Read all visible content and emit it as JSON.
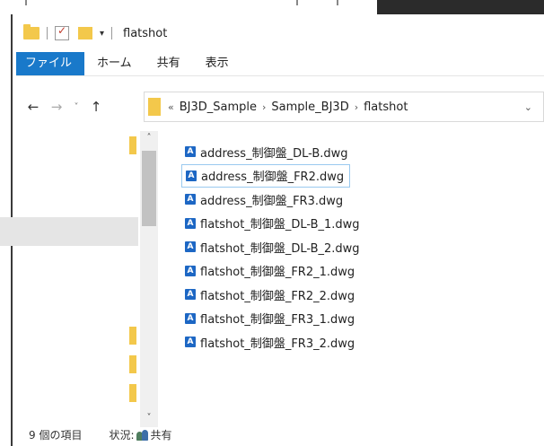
{
  "window": {
    "title": "flatshot",
    "quick_access_dropdown": "▾"
  },
  "ribbon": {
    "tabs": [
      {
        "label": "ファイル"
      },
      {
        "label": "ホーム"
      },
      {
        "label": "共有"
      },
      {
        "label": "表示"
      }
    ]
  },
  "navigation": {
    "back_glyph": "←",
    "forward_glyph": "→",
    "recent_glyph": "˅",
    "up_glyph": "↑"
  },
  "address_bar": {
    "overflow": "«",
    "crumbs": [
      "BJ3D_Sample",
      "Sample_BJ3D",
      "flatshot"
    ],
    "separator": "›",
    "dropdown": "⌄"
  },
  "scrollbar": {
    "up_glyph": "˄",
    "down_glyph": "˅"
  },
  "files": [
    {
      "name": "address_制御盤_DL-B.dwg",
      "icon": "dwg-file-icon"
    },
    {
      "name": "address_制御盤_FR2.dwg",
      "icon": "dwg-file-icon",
      "selected": true
    },
    {
      "name": "address_制御盤_FR3.dwg",
      "icon": "dwg-file-icon"
    },
    {
      "name": "flatshot_制御盤_DL-B_1.dwg",
      "icon": "dwg-file-icon"
    },
    {
      "name": "flatshot_制御盤_DL-B_2.dwg",
      "icon": "dwg-file-icon"
    },
    {
      "name": "flatshot_制御盤_FR2_1.dwg",
      "icon": "dwg-file-icon"
    },
    {
      "name": "flatshot_制御盤_FR2_2.dwg",
      "icon": "dwg-file-icon"
    },
    {
      "name": "flatshot_制御盤_FR3_1.dwg",
      "icon": "dwg-file-icon"
    },
    {
      "name": "flatshot_制御盤_FR3_2.dwg",
      "icon": "dwg-file-icon"
    }
  ],
  "status": {
    "item_count": "9 個の項目",
    "state_label": "状況:",
    "state_value": "共有"
  },
  "colors": {
    "accent": "#1979ca",
    "folder": "#f3c84b",
    "dwg_icon": "#1d67c4",
    "selection_border": "#99c9ef"
  }
}
